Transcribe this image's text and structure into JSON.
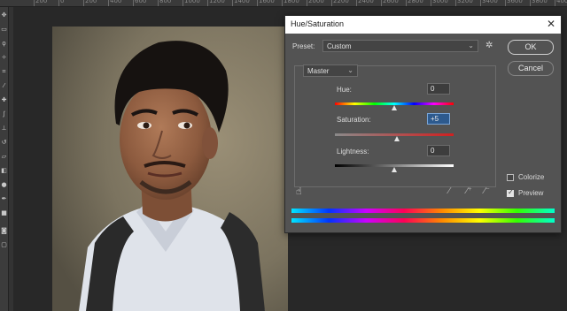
{
  "ruler_ticks": [
    "200",
    "0",
    "200",
    "400",
    "600",
    "800",
    "1000",
    "1200",
    "1400",
    "1600",
    "1800",
    "2000",
    "2200",
    "2400",
    "2600",
    "2800",
    "3000",
    "3200",
    "3400",
    "3600",
    "3800",
    "4000",
    "4200"
  ],
  "dialog": {
    "title": "Hue/Saturation",
    "preset_label": "Preset:",
    "preset_value": "Custom",
    "channel_value": "Master",
    "ok_label": "OK",
    "cancel_label": "Cancel",
    "hue": {
      "label": "Hue:",
      "value": "0"
    },
    "saturation": {
      "label": "Saturation:",
      "value": "+5"
    },
    "lightness": {
      "label": "Lightness:",
      "value": "0"
    },
    "colorize_label": "Colorize",
    "colorize_checked": false,
    "preview_label": "Preview",
    "preview_checked": true
  },
  "icons": {
    "close": "close-icon",
    "gear": "gear-icon",
    "hand": "target-adjust-hand-icon",
    "eyedroppers": [
      "eyedropper-icon",
      "eyedropper-plus-icon",
      "eyedropper-minus-icon"
    ]
  }
}
